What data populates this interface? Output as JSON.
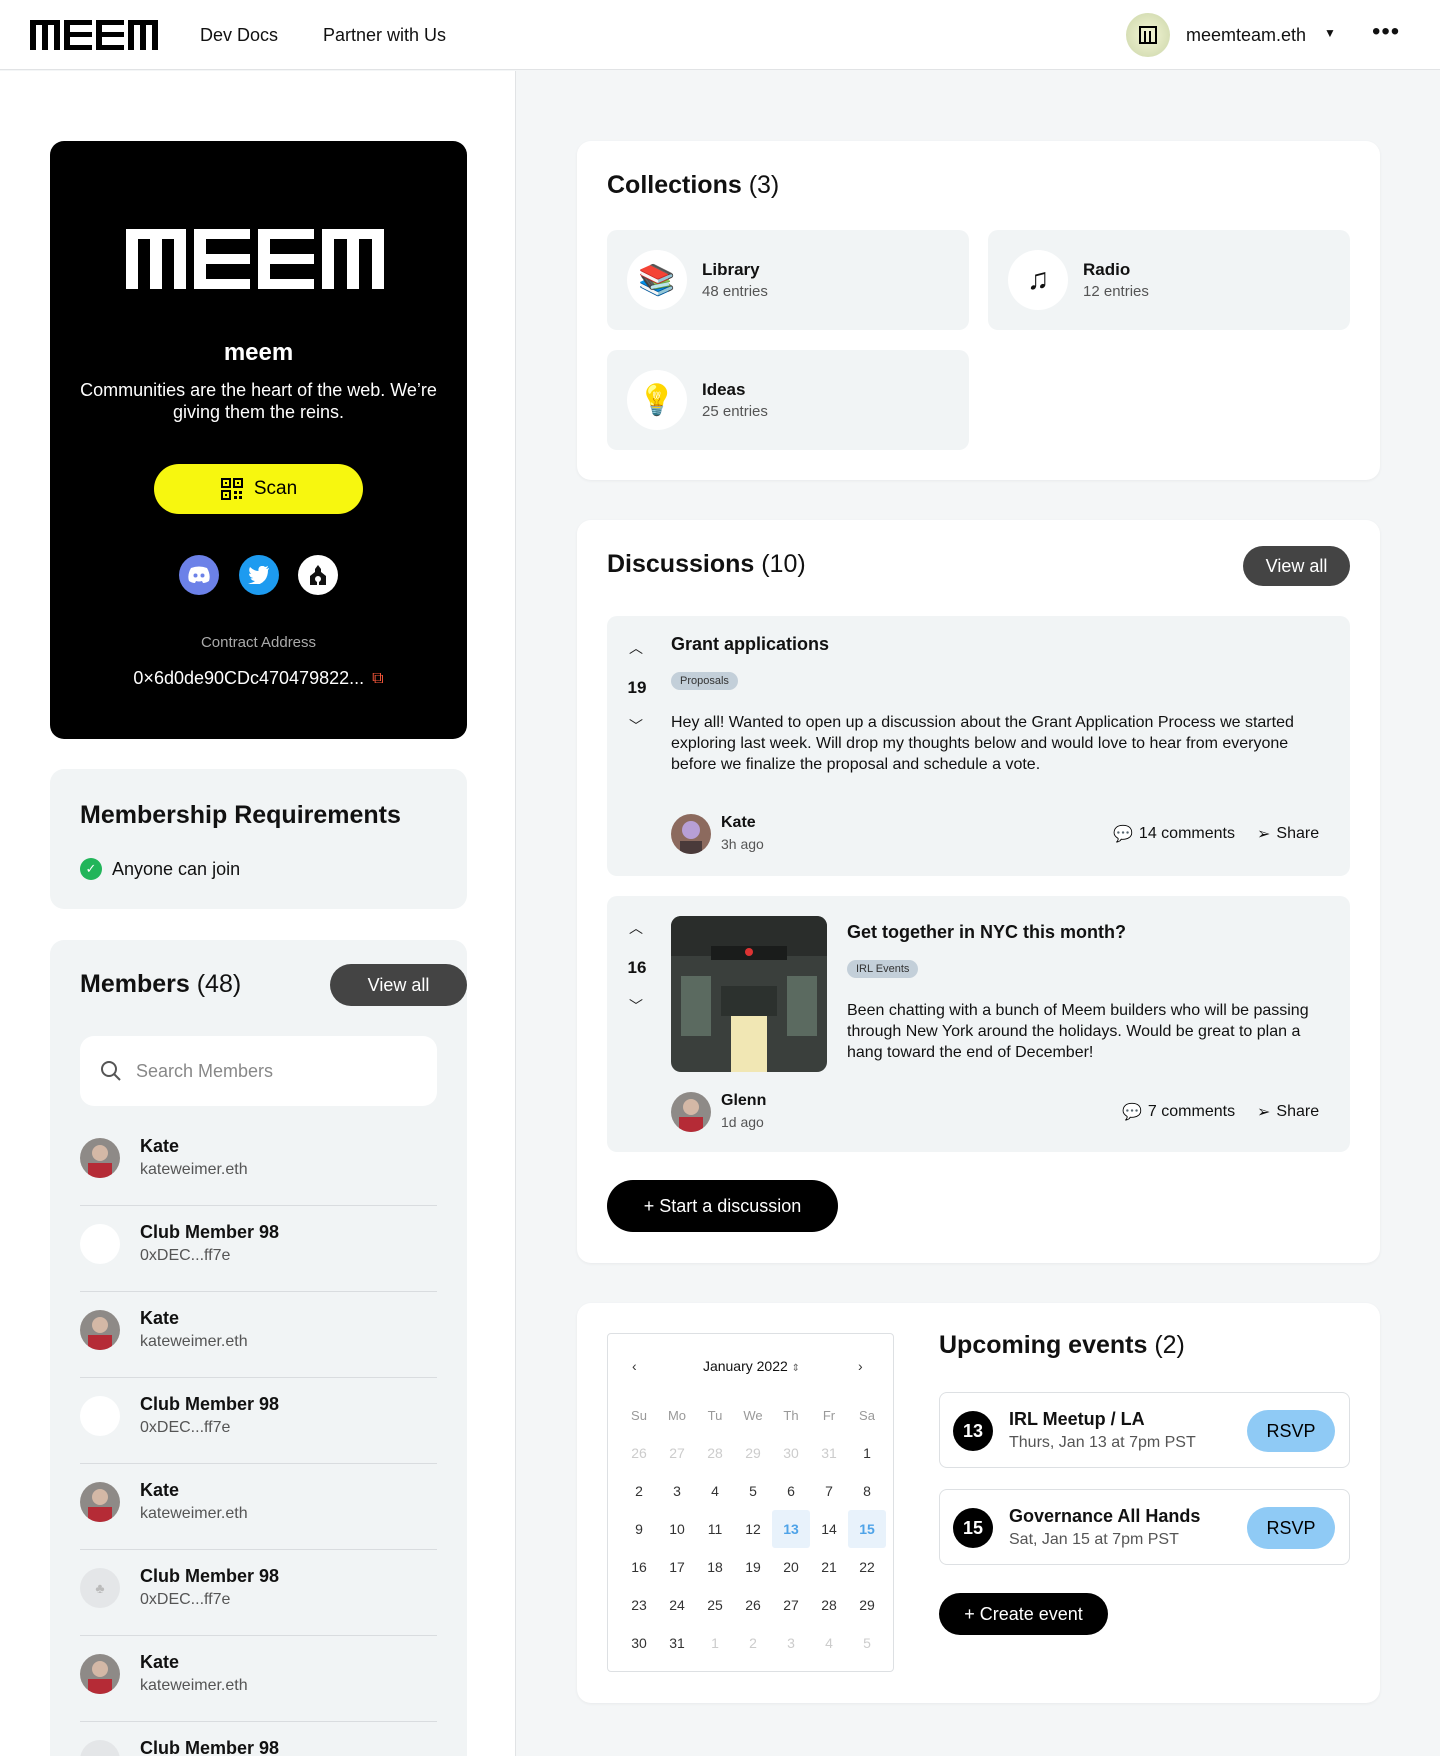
{
  "header": {
    "logo_text": "meem",
    "nav": [
      {
        "label": "Dev Docs"
      },
      {
        "label": "Partner with Us"
      }
    ],
    "account_name": "meemteam.eth",
    "more_label": "•••"
  },
  "club": {
    "name": "meem",
    "description": "Communities are the heart of the web. We’re giving them the reins.",
    "scan_label": "Scan",
    "socials": [
      "discord-icon",
      "twitter-icon",
      "mirror-icon"
    ],
    "contract_label": "Contract Address",
    "contract_address": "0×6d0de90CDc470479822..."
  },
  "requirements": {
    "title": "Membership Requirements",
    "items": [
      {
        "label": "Anyone can join"
      }
    ]
  },
  "members": {
    "title": "Members",
    "count": "(48)",
    "view_all": "View all",
    "search_placeholder": "Search Members",
    "list": [
      {
        "name": "Kate",
        "sub": "kateweimer.eth"
      },
      {
        "name": "Club Member 98",
        "sub": "0xDEC...ff7e"
      },
      {
        "name": "Kate",
        "sub": "kateweimer.eth"
      },
      {
        "name": "Club Member 98",
        "sub": "0xDEC...ff7e"
      },
      {
        "name": "Kate",
        "sub": "kateweimer.eth"
      },
      {
        "name": "Club Member 98",
        "sub": "0xDEC...ff7e"
      },
      {
        "name": "Kate",
        "sub": "kateweimer.eth"
      },
      {
        "name": "Club Member 98",
        "sub": ""
      }
    ]
  },
  "collections": {
    "title": "Collections",
    "count": "(3)",
    "items": [
      {
        "name": "Library",
        "entries": "48 entries",
        "icon": "books-icon"
      },
      {
        "name": "Radio",
        "entries": "12 entries",
        "icon": "music-note-icon"
      },
      {
        "name": "Ideas",
        "entries": "25 entries",
        "icon": "lightbulb-icon"
      }
    ]
  },
  "discussions": {
    "title": "Discussions",
    "count": "(10)",
    "view_all": "View all",
    "start_label": "+ Start a discussion",
    "posts": [
      {
        "votes": "19",
        "title": "Grant applications",
        "tag": "Proposals",
        "body": "Hey all! Wanted to open up a discussion about the Grant Application Process we started exploring last week. Will drop my thoughts below and would love to hear from everyone before we finalize the proposal and schedule a vote.",
        "author": "Kate",
        "time": "3h ago",
        "comments": "14 comments",
        "share": "Share"
      },
      {
        "votes": "16",
        "title": "Get together in NYC this month?",
        "tag": "IRL Events",
        "body": "Been chatting with a bunch of Meem builders who will be passing through New York around the holidays. Would be great to plan a hang toward the end of December!",
        "author": "Glenn",
        "time": "1d ago",
        "comments": "7 comments",
        "share": "Share"
      }
    ]
  },
  "calendar": {
    "month": "January 2022",
    "weekdays": [
      "Su",
      "Mo",
      "Tu",
      "We",
      "Th",
      "Fr",
      "Sa"
    ],
    "days": [
      {
        "d": "26",
        "m": true
      },
      {
        "d": "27",
        "m": true
      },
      {
        "d": "28",
        "m": true
      },
      {
        "d": "29",
        "m": true
      },
      {
        "d": "30",
        "m": true
      },
      {
        "d": "31",
        "m": true
      },
      {
        "d": "1"
      },
      {
        "d": "2"
      },
      {
        "d": "3"
      },
      {
        "d": "4"
      },
      {
        "d": "5"
      },
      {
        "d": "6"
      },
      {
        "d": "7"
      },
      {
        "d": "8"
      },
      {
        "d": "9"
      },
      {
        "d": "10"
      },
      {
        "d": "11"
      },
      {
        "d": "12"
      },
      {
        "d": "13",
        "h": true
      },
      {
        "d": "14"
      },
      {
        "d": "15",
        "h": true
      },
      {
        "d": "16"
      },
      {
        "d": "17"
      },
      {
        "d": "18"
      },
      {
        "d": "19"
      },
      {
        "d": "20"
      },
      {
        "d": "21"
      },
      {
        "d": "22"
      },
      {
        "d": "23"
      },
      {
        "d": "24"
      },
      {
        "d": "25"
      },
      {
        "d": "26"
      },
      {
        "d": "27"
      },
      {
        "d": "28"
      },
      {
        "d": "29"
      },
      {
        "d": "30"
      },
      {
        "d": "31"
      },
      {
        "d": "1",
        "m": true
      },
      {
        "d": "2",
        "m": true
      },
      {
        "d": "3",
        "m": true
      },
      {
        "d": "4",
        "m": true
      },
      {
        "d": "5",
        "m": true
      }
    ]
  },
  "events": {
    "title": "Upcoming events",
    "count": "(2)",
    "create_label": "+ Create event",
    "items": [
      {
        "day": "13",
        "name": "IRL Meetup / LA",
        "when": "Thurs, Jan 13 at 7pm PST",
        "rsvp": "RSVP"
      },
      {
        "day": "15",
        "name": "Governance All Hands",
        "when": "Sat, Jan 15 at 7pm PST",
        "rsvp": "RSVP"
      }
    ]
  },
  "colors": {
    "accent_yellow": "#f7f70f",
    "rsvp_blue": "#8fcaf5",
    "success_green": "#22b55a",
    "copy_red": "#ff5a3c"
  }
}
